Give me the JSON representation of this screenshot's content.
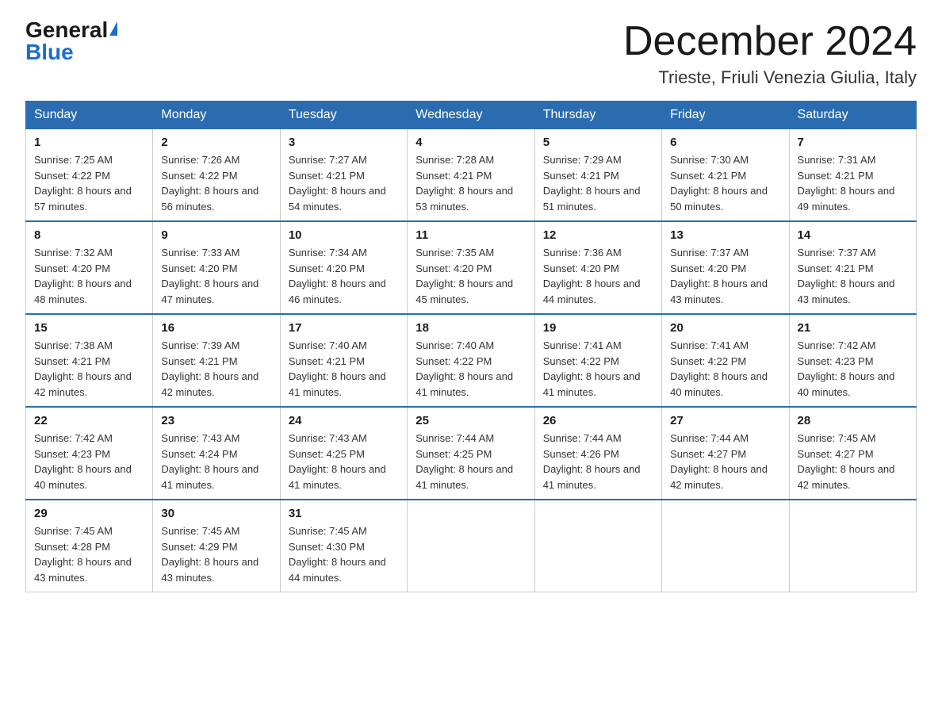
{
  "logo": {
    "general": "General",
    "blue": "Blue"
  },
  "title": {
    "month_year": "December 2024",
    "location": "Trieste, Friuli Venezia Giulia, Italy"
  },
  "headers": [
    "Sunday",
    "Monday",
    "Tuesday",
    "Wednesday",
    "Thursday",
    "Friday",
    "Saturday"
  ],
  "weeks": [
    [
      {
        "day": "1",
        "sunrise": "7:25 AM",
        "sunset": "4:22 PM",
        "daylight": "8 hours and 57 minutes."
      },
      {
        "day": "2",
        "sunrise": "7:26 AM",
        "sunset": "4:22 PM",
        "daylight": "8 hours and 56 minutes."
      },
      {
        "day": "3",
        "sunrise": "7:27 AM",
        "sunset": "4:21 PM",
        "daylight": "8 hours and 54 minutes."
      },
      {
        "day": "4",
        "sunrise": "7:28 AM",
        "sunset": "4:21 PM",
        "daylight": "8 hours and 53 minutes."
      },
      {
        "day": "5",
        "sunrise": "7:29 AM",
        "sunset": "4:21 PM",
        "daylight": "8 hours and 51 minutes."
      },
      {
        "day": "6",
        "sunrise": "7:30 AM",
        "sunset": "4:21 PM",
        "daylight": "8 hours and 50 minutes."
      },
      {
        "day": "7",
        "sunrise": "7:31 AM",
        "sunset": "4:21 PM",
        "daylight": "8 hours and 49 minutes."
      }
    ],
    [
      {
        "day": "8",
        "sunrise": "7:32 AM",
        "sunset": "4:20 PM",
        "daylight": "8 hours and 48 minutes."
      },
      {
        "day": "9",
        "sunrise": "7:33 AM",
        "sunset": "4:20 PM",
        "daylight": "8 hours and 47 minutes."
      },
      {
        "day": "10",
        "sunrise": "7:34 AM",
        "sunset": "4:20 PM",
        "daylight": "8 hours and 46 minutes."
      },
      {
        "day": "11",
        "sunrise": "7:35 AM",
        "sunset": "4:20 PM",
        "daylight": "8 hours and 45 minutes."
      },
      {
        "day": "12",
        "sunrise": "7:36 AM",
        "sunset": "4:20 PM",
        "daylight": "8 hours and 44 minutes."
      },
      {
        "day": "13",
        "sunrise": "7:37 AM",
        "sunset": "4:20 PM",
        "daylight": "8 hours and 43 minutes."
      },
      {
        "day": "14",
        "sunrise": "7:37 AM",
        "sunset": "4:21 PM",
        "daylight": "8 hours and 43 minutes."
      }
    ],
    [
      {
        "day": "15",
        "sunrise": "7:38 AM",
        "sunset": "4:21 PM",
        "daylight": "8 hours and 42 minutes."
      },
      {
        "day": "16",
        "sunrise": "7:39 AM",
        "sunset": "4:21 PM",
        "daylight": "8 hours and 42 minutes."
      },
      {
        "day": "17",
        "sunrise": "7:40 AM",
        "sunset": "4:21 PM",
        "daylight": "8 hours and 41 minutes."
      },
      {
        "day": "18",
        "sunrise": "7:40 AM",
        "sunset": "4:22 PM",
        "daylight": "8 hours and 41 minutes."
      },
      {
        "day": "19",
        "sunrise": "7:41 AM",
        "sunset": "4:22 PM",
        "daylight": "8 hours and 41 minutes."
      },
      {
        "day": "20",
        "sunrise": "7:41 AM",
        "sunset": "4:22 PM",
        "daylight": "8 hours and 40 minutes."
      },
      {
        "day": "21",
        "sunrise": "7:42 AM",
        "sunset": "4:23 PM",
        "daylight": "8 hours and 40 minutes."
      }
    ],
    [
      {
        "day": "22",
        "sunrise": "7:42 AM",
        "sunset": "4:23 PM",
        "daylight": "8 hours and 40 minutes."
      },
      {
        "day": "23",
        "sunrise": "7:43 AM",
        "sunset": "4:24 PM",
        "daylight": "8 hours and 41 minutes."
      },
      {
        "day": "24",
        "sunrise": "7:43 AM",
        "sunset": "4:25 PM",
        "daylight": "8 hours and 41 minutes."
      },
      {
        "day": "25",
        "sunrise": "7:44 AM",
        "sunset": "4:25 PM",
        "daylight": "8 hours and 41 minutes."
      },
      {
        "day": "26",
        "sunrise": "7:44 AM",
        "sunset": "4:26 PM",
        "daylight": "8 hours and 41 minutes."
      },
      {
        "day": "27",
        "sunrise": "7:44 AM",
        "sunset": "4:27 PM",
        "daylight": "8 hours and 42 minutes."
      },
      {
        "day": "28",
        "sunrise": "7:45 AM",
        "sunset": "4:27 PM",
        "daylight": "8 hours and 42 minutes."
      }
    ],
    [
      {
        "day": "29",
        "sunrise": "7:45 AM",
        "sunset": "4:28 PM",
        "daylight": "8 hours and 43 minutes."
      },
      {
        "day": "30",
        "sunrise": "7:45 AM",
        "sunset": "4:29 PM",
        "daylight": "8 hours and 43 minutes."
      },
      {
        "day": "31",
        "sunrise": "7:45 AM",
        "sunset": "4:30 PM",
        "daylight": "8 hours and 44 minutes."
      },
      null,
      null,
      null,
      null
    ]
  ]
}
